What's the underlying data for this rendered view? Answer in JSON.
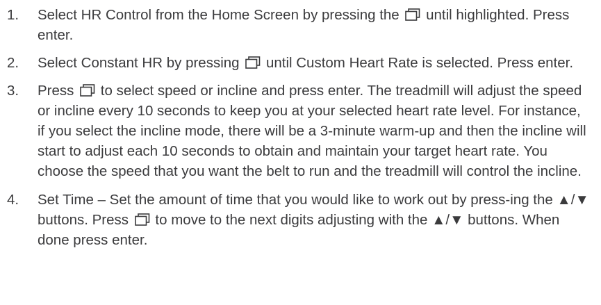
{
  "steps": [
    {
      "number": "1.",
      "text_a": "Select HR Control from the Home Screen by pressing the ",
      "icon": "select-button-icon",
      "text_b": " until highlighted. Press enter."
    },
    {
      "number": "2.",
      "text_a": "Select Constant HR by pressing ",
      "icon": "select-button-icon",
      "text_b": " until Custom Heart Rate is selected. Press enter."
    },
    {
      "number": "3.",
      "text_a": "Press ",
      "icon": "select-button-icon",
      "text_b": " to select speed or incline and press enter. The treadmill will adjust the speed or incline every 10 seconds to keep you at your selected heart rate level. For instance, if you select the incline mode, there will be a 3-minute warm-up and then the incline will start to adjust each 10 seconds to obtain and maintain your target heart rate. You choose the speed that you want the belt to run and the treadmill will control the incline."
    },
    {
      "number": "4.",
      "text_a": "Set Time – Set the amount of time that you would like to work out by press-ing the ▲/▼ buttons. Press ",
      "icon": "select-button-icon",
      "text_b": " to move to the next digits adjusting with the ▲/▼ buttons. When done press enter."
    }
  ]
}
